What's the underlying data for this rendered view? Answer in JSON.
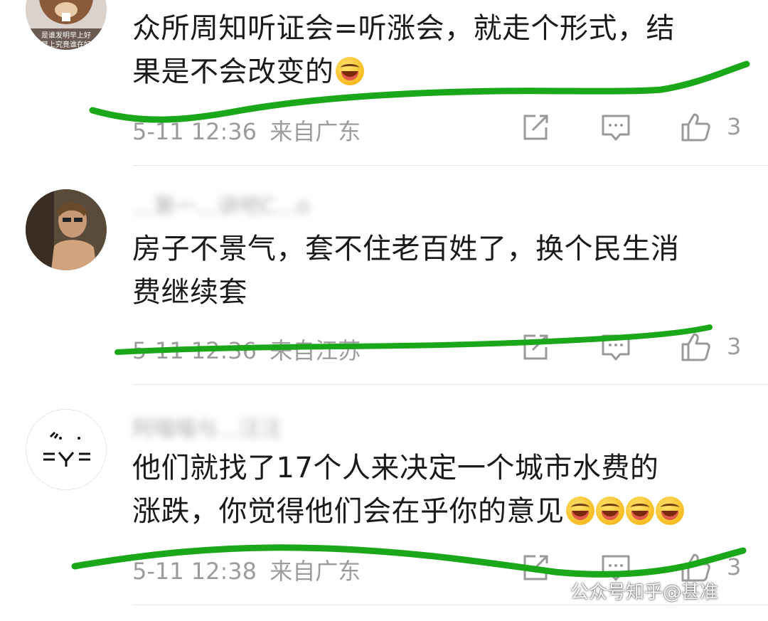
{
  "comments": [
    {
      "username": "",
      "text_line1": "众所周知听证会=听涨会，就走个形式，结",
      "text_line2": "果是不会改变的",
      "emoji": "😂",
      "time": "5-11 12:36",
      "location": "来自广东",
      "likes": "3",
      "avatar_caption_1": "是谁发明早上好",
      "avatar_caption_2": "早上究竟谁在好"
    },
    {
      "username": "…第一…讲吧C…o",
      "text_line1": "房子不景气，套不住老百姓了，换个民生消",
      "text_line2": "费继续套",
      "time": "5-11 12:36",
      "location": "来自江苏",
      "likes": "3"
    },
    {
      "username": "阿喵喵与…汪汪",
      "text_line1": "他们就找了17个人来决定一个城市水费的",
      "text_line2": "涨跌，你觉得他们会在乎你的意见",
      "emoji_count": 4,
      "time": "5-11 12:38",
      "location": "来自广东",
      "likes": "3"
    }
  ],
  "icons": {
    "share": "share-icon",
    "reply": "comment-icon",
    "like": "thumbs-up-icon"
  },
  "watermark": {
    "text": "公众号知乎@甚准"
  },
  "colors": {
    "annotation_green": "#1aa81a",
    "meta_gray": "#9c9c9c",
    "text": "#1a1a1a"
  }
}
